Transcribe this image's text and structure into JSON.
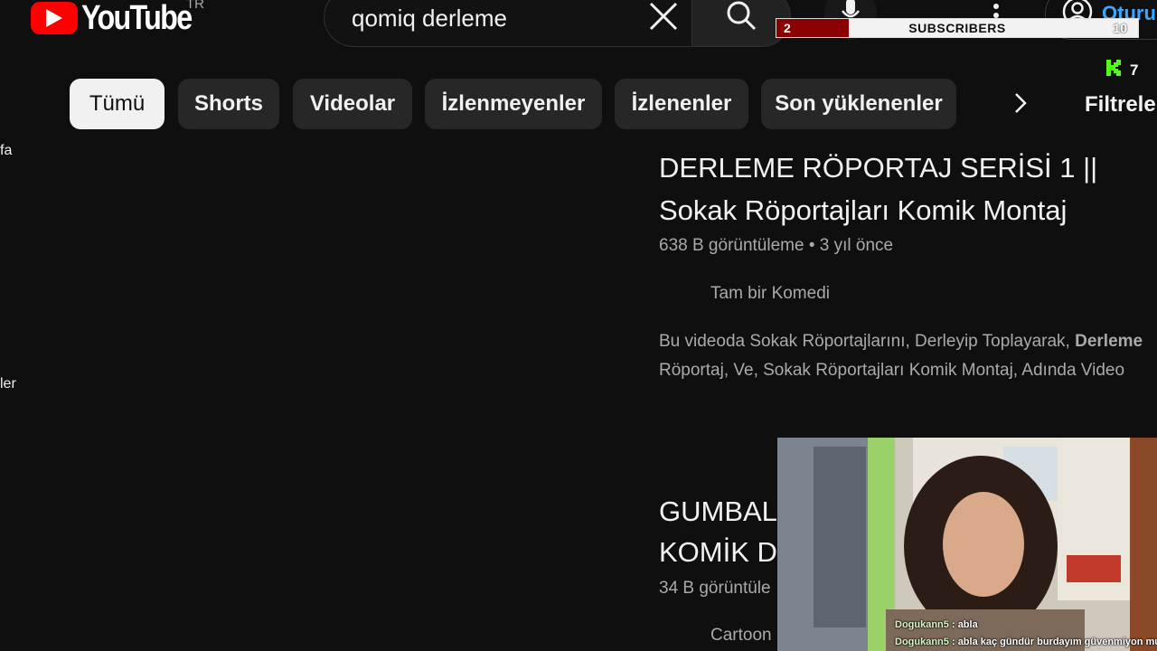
{
  "header": {
    "logo_text": "YouTube",
    "region": "TR",
    "search_value": "qomiq derleme",
    "signin_label": "Oturu"
  },
  "overlay": {
    "subscribers": {
      "current": "2",
      "label": "SUBSCRIBERS",
      "goal": "10",
      "progress": 0.2
    },
    "kick_viewers": "7"
  },
  "chips": [
    "Tümü",
    "Shorts",
    "Videolar",
    "İzlenmeyenler",
    "İzlenenler",
    "Son yüklenenler"
  ],
  "filters_label": "Filtreler",
  "sidebar_fragments": [
    "fa",
    "ler"
  ],
  "results": [
    {
      "title_line1": "DERLEME RÖPORTAJ SERİSİ 1 ||",
      "title_line2": "Sokak Röportajları Komik Montaj",
      "views": "638 B görüntüleme",
      "age": "3 yıl önce",
      "channel": "Tam bir Komedi",
      "desc_line1_plain": "Bu videoda Sokak Röportajlarını, Derleyip Toplayarak, ",
      "desc_line1_bold": "Derleme",
      "desc_line2": "Röportaj, Ve, Sokak Röportajları Komik Montaj, Adında Video"
    },
    {
      "title_line1": "GUMBALL",
      "title_line2": "KOMİK De",
      "views": "34 B görüntüle",
      "channel": "Cartoon"
    }
  ],
  "chat": [
    {
      "user": "Dogukann5",
      "message": ": abla"
    },
    {
      "user": "Dogukann5",
      "message": ": abla kaç gündür burdayım güvenmiyon mu"
    }
  ],
  "colors": {
    "bg": "#0f0f0f",
    "brand_red": "#ff0000",
    "kick_green": "#53fc18",
    "link_blue": "#3ea6ff"
  }
}
